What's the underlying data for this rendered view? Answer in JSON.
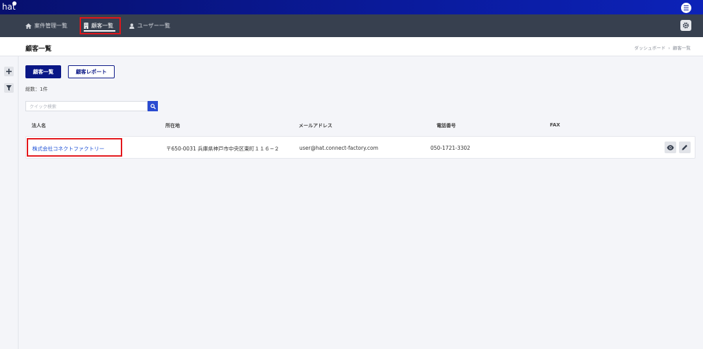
{
  "app": {
    "logo_text": "hat"
  },
  "nav": {
    "items": [
      {
        "label": "案件管理一覧",
        "icon": "home-icon"
      },
      {
        "label": "顧客一覧",
        "icon": "building-icon"
      },
      {
        "label": "ユーザー一覧",
        "icon": "user-icon"
      }
    ],
    "active_index": 1
  },
  "header": {
    "title": "顧客一覧",
    "breadcrumb": [
      "ダッシュボード",
      "顧客一覧"
    ]
  },
  "sidebar": {
    "buttons": [
      {
        "icon": "plus-icon"
      },
      {
        "icon": "filter-icon"
      }
    ]
  },
  "tabs": {
    "primary": "顧客一覧",
    "secondary": "顧客レポート"
  },
  "summary": {
    "count_text": "総数：1件"
  },
  "search": {
    "placeholder": "クイック検索",
    "value": ""
  },
  "table": {
    "columns": [
      "法人名",
      "所在地",
      "メールアドレス",
      "電話番号",
      "FAX"
    ],
    "rows": [
      {
        "name": "株式会社コネクトファクトリー",
        "address": "〒650-0031 兵庫県神戸市中央区東町１１６−２",
        "email": "user@hat.connect-factory.com",
        "phone": "050-1721-3302",
        "fax": ""
      }
    ]
  },
  "colors": {
    "brand_dark": "#07106e",
    "nav_bg": "#37404f",
    "primary_button": "#0a1786",
    "link": "#1c4fd6",
    "highlight_box": "#e3161b",
    "search_button": "#2a4bd1"
  }
}
